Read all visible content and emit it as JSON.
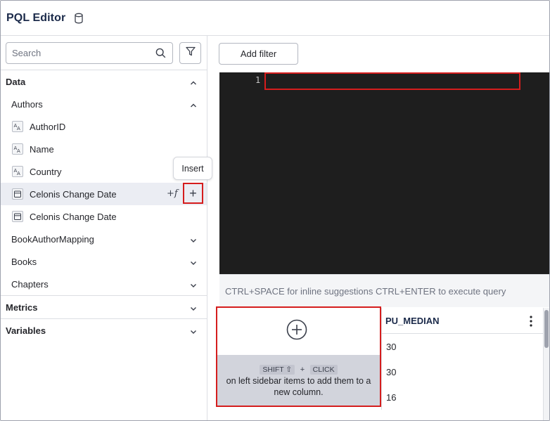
{
  "header": {
    "title": "PQL Editor",
    "db_icon": "database-icon"
  },
  "sidebar": {
    "search_placeholder": "Search",
    "sections": {
      "data": "Data",
      "metrics": "Metrics",
      "variables": "Variables"
    },
    "tables": {
      "authors": "Authors",
      "book_author_mapping": "BookAuthorMapping",
      "books": "Books",
      "chapters": "Chapters"
    },
    "author_columns": [
      {
        "label": "AuthorID",
        "icon": "text-type-icon"
      },
      {
        "label": "Name",
        "icon": "text-type-icon"
      },
      {
        "label": "Country",
        "icon": "text-type-icon"
      },
      {
        "label": "Celonis Change Date",
        "icon": "date-type-icon"
      },
      {
        "label": "Celonis Change Date",
        "icon": "date-type-icon"
      }
    ],
    "tooltip": "Insert",
    "insert_glyph": "+",
    "fx_glyph": "+f"
  },
  "main": {
    "add_filter_label": "Add filter",
    "editor": {
      "line_number": "1",
      "content": ""
    },
    "hint": "CTRL+SPACE for inline suggestions CTRL+ENTER to execute query",
    "add_column": {
      "key1": "SHIFT ⇧",
      "plus": "+",
      "key2": "CLICK",
      "line1": "on left sidebar items to add them to a",
      "line2": "new column."
    },
    "table": {
      "column": "PU_MEDIAN",
      "rows": [
        "30",
        "30",
        "16"
      ]
    }
  },
  "colors": {
    "highlight_border": "#d51d1d",
    "editor_bg": "#1e1e1e",
    "selected_row": "#ebedf3"
  }
}
